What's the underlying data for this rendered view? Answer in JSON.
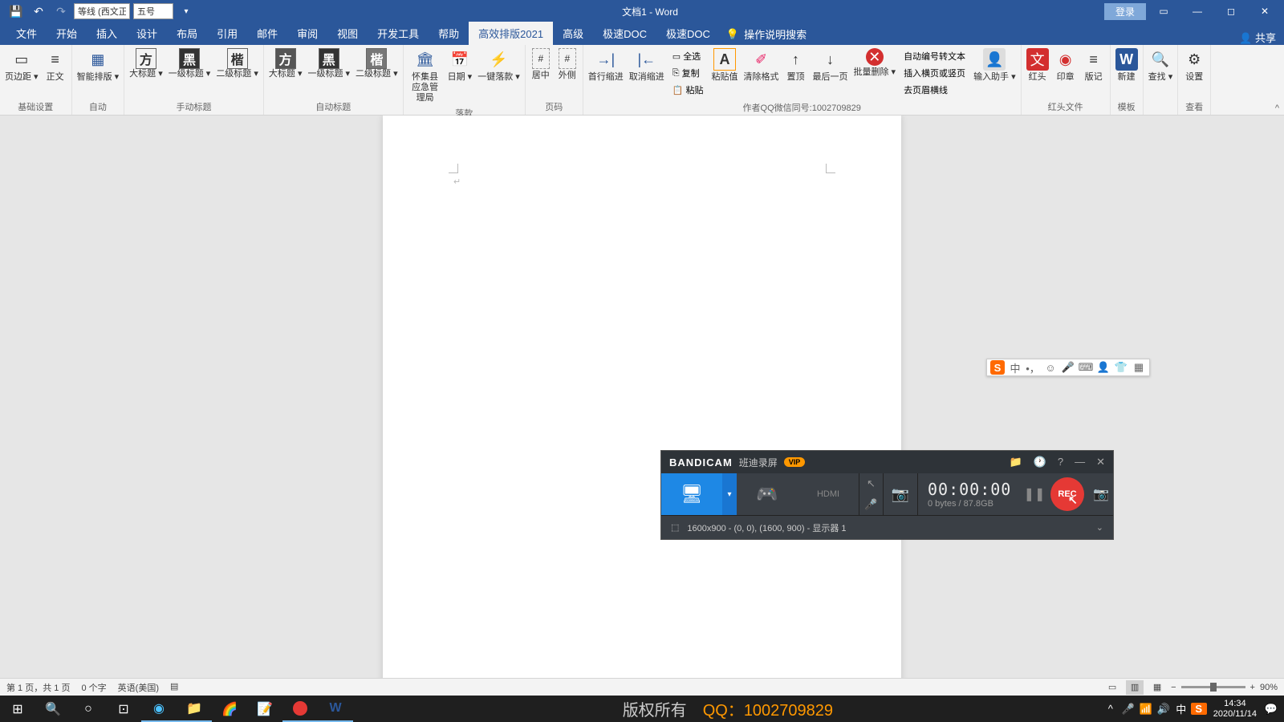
{
  "title": "文档1  -  Word",
  "qat": {
    "font": "等线 (西文正",
    "size": "五号"
  },
  "titlebar_buttons": {
    "login": "登录"
  },
  "tabs": [
    "文件",
    "开始",
    "插入",
    "设计",
    "布局",
    "引用",
    "邮件",
    "审阅",
    "视图",
    "开发工具",
    "帮助",
    "高效排版2021",
    "高级",
    "极速DOC",
    "极速DOC"
  ],
  "active_tab": 11,
  "tell_me": "操作说明搜索",
  "share": "共享",
  "ribbon": {
    "g1": {
      "label": "基础设置",
      "items": [
        {
          "label": "页边距 ▾",
          "icon": "▭"
        },
        {
          "label": "正文",
          "icon": "≡"
        }
      ]
    },
    "g2": {
      "label": "自动",
      "items": [
        {
          "label": "智能排版 ▾",
          "icon": "▦"
        }
      ]
    },
    "g3": {
      "label": "手动标题",
      "items": [
        {
          "label": "大标题 ▾",
          "icon": "方"
        },
        {
          "label": "一级标题 ▾",
          "icon": "黑"
        },
        {
          "label": "二级标题 ▾",
          "icon": "楷"
        }
      ]
    },
    "g4": {
      "label": "自动标题",
      "items": [
        {
          "label": "大标题 ▾",
          "icon": "方"
        },
        {
          "label": "一级标题 ▾",
          "icon": "黑"
        },
        {
          "label": "二级标题 ▾",
          "icon": "楷"
        }
      ]
    },
    "g5": {
      "label": "落款",
      "items": [
        {
          "label": "怀集县应急管理局",
          "icon": "🏛"
        },
        {
          "label": "日期 ▾",
          "icon": "📅"
        },
        {
          "label": "一键落款 ▾",
          "icon": "⚡"
        }
      ]
    },
    "g6": {
      "label": "页码",
      "items": [
        {
          "label": "居中",
          "icon": "#"
        },
        {
          "label": "外侧",
          "icon": "#"
        }
      ]
    },
    "g7": {
      "label": "作者QQ微信同号:1002709829",
      "items": [
        {
          "label": "首行缩进",
          "icon": "→|"
        },
        {
          "label": "取消缩进",
          "icon": "|←"
        },
        {
          "small": [
            {
              "label": "全选",
              "icon": "▭"
            },
            {
              "label": "复制",
              "icon": "⎘"
            },
            {
              "label": "粘贴",
              "icon": "📋"
            }
          ]
        },
        {
          "label": "粘贴值",
          "icon": "A"
        },
        {
          "label": "清除格式",
          "icon": "✐"
        },
        {
          "label": "置顶",
          "icon": "↑"
        },
        {
          "label": "最后一页",
          "icon": "↓"
        },
        {
          "label": "批量删除 ▾",
          "icon": "✕"
        },
        {
          "small2": [
            {
              "label": "自动编号转文本"
            },
            {
              "label": "插入横页或竖页"
            },
            {
              "label": "去页眉横线"
            }
          ]
        },
        {
          "label": "输入助手 ▾",
          "icon": "👤"
        }
      ]
    },
    "g8": {
      "label": "红头文件",
      "items": [
        {
          "label": "红头",
          "icon": "文",
          "color": "#d32f2f"
        },
        {
          "label": "印章",
          "icon": "◉",
          "color": "#d32f2f"
        },
        {
          "label": "版记",
          "icon": "≡"
        }
      ]
    },
    "g9": {
      "label": "模板",
      "items": [
        {
          "label": "新建",
          "icon": "W",
          "color": "#2b579a"
        }
      ]
    },
    "g10": {
      "label": "",
      "items": [
        {
          "label": "查找 ▾",
          "icon": "🔍"
        }
      ]
    },
    "g11": {
      "label": "查看",
      "items": [
        {
          "label": "设置",
          "icon": "⚙"
        }
      ]
    }
  },
  "statusbar": {
    "page": "第 1 页，共 1 页",
    "words": "0 个字",
    "lang": "英语(美国)",
    "zoom": "90%"
  },
  "taskbar": {
    "copyright": "版权所有",
    "qq_label": "QQ：",
    "qq_number": "1002709829",
    "ime": "中",
    "time": "14:34",
    "date": "2020/11/14"
  },
  "bandicam": {
    "brand": "BANDICAM",
    "subtitle": "班迪录屏",
    "vip": "VIP",
    "timer": "00:00:00",
    "bytes": "0 bytes / 87.8GB",
    "rec": "REC",
    "status": "1600x900 - (0, 0), (1600, 900) - 显示器 1"
  },
  "ime_bar": {
    "zh": "中"
  }
}
